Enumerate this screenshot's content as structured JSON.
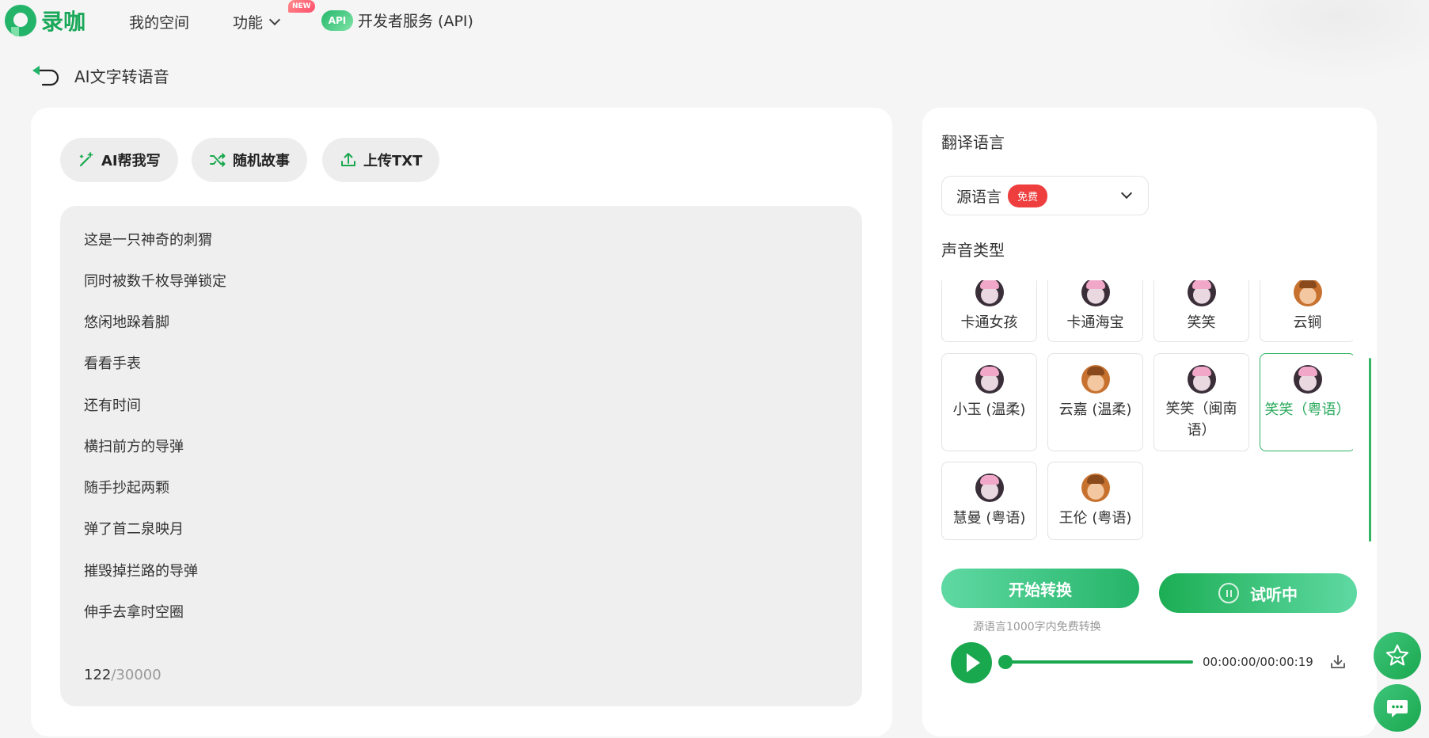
{
  "brand": {
    "name": "录咖"
  },
  "nav": {
    "my_space": "我的空间",
    "features": "功能",
    "new_badge": "NEW",
    "api_icon_text": "API",
    "developer": "开发者服务 (API)"
  },
  "page": {
    "title": "AI文字转语音"
  },
  "tools": {
    "ai_write": "AI帮我写",
    "random_story": "随机故事",
    "upload_txt": "上传TXT"
  },
  "editor": {
    "lines": [
      "这是一只神奇的刺猬",
      "同时被数千枚导弹锁定",
      "悠闲地跺着脚",
      "看看手表",
      "还有时间",
      "横扫前方的导弹",
      "随手抄起两颗",
      "弹了首二泉映月",
      "摧毁掉拦路的导弹",
      "伸手去拿时空圈"
    ],
    "count": "122",
    "max": "/30000"
  },
  "right": {
    "translate_title": "翻译语言",
    "source_lang": "源语言",
    "free_badge": "免费",
    "voice_type_title": "声音类型",
    "voices": [
      {
        "name": "卡通女孩",
        "avatar": "girl"
      },
      {
        "name": "卡通海宝",
        "avatar": "girl"
      },
      {
        "name": "笑笑",
        "avatar": "girl"
      },
      {
        "name": "云锏",
        "avatar": "boy"
      },
      {
        "name": "小玉 (温柔)",
        "avatar": "girl"
      },
      {
        "name": "云嘉 (温柔)",
        "avatar": "boy"
      },
      {
        "name": "笑笑（闽南语）",
        "avatar": "girl"
      },
      {
        "name": "笑笑（粤语）",
        "avatar": "girl",
        "selected": true
      },
      {
        "name": "慧曼 (粤语)",
        "avatar": "girl"
      },
      {
        "name": "王伦 (粤语)",
        "avatar": "boy"
      }
    ],
    "start_label": "开始转换",
    "listening_label": "试听中",
    "free_note": "源语言1000字内免费转换",
    "player": {
      "time": "00:00:00/00:00:19",
      "progress": 0
    }
  },
  "colors": {
    "accent": "#1aa84f",
    "danger": "#ee3e3e"
  }
}
